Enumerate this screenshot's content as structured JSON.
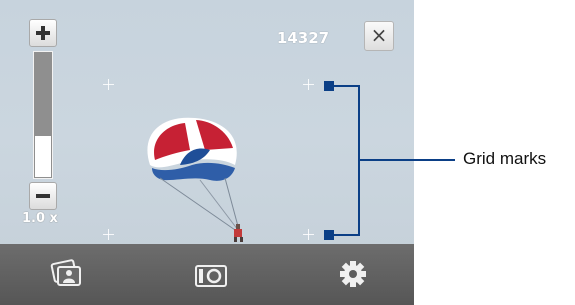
{
  "viewfinder": {
    "shot_counter": "14327",
    "zoom_level_label": "1.0 x",
    "zoom_fraction": 0.33,
    "zoom_in_icon": "plus-icon",
    "zoom_out_icon": "minus-icon",
    "close_icon": "close-icon",
    "close_label": "×"
  },
  "toolbar": {
    "items": [
      {
        "icon": "album-icon"
      },
      {
        "icon": "camera-mode-icon"
      },
      {
        "icon": "settings-gear-icon"
      }
    ]
  },
  "annotation": {
    "label": "Grid marks",
    "color": "#0b3f86"
  },
  "colors": {
    "sky": "#c8d3dc",
    "toolbar": "#616161",
    "text_white": "#ffffff"
  }
}
